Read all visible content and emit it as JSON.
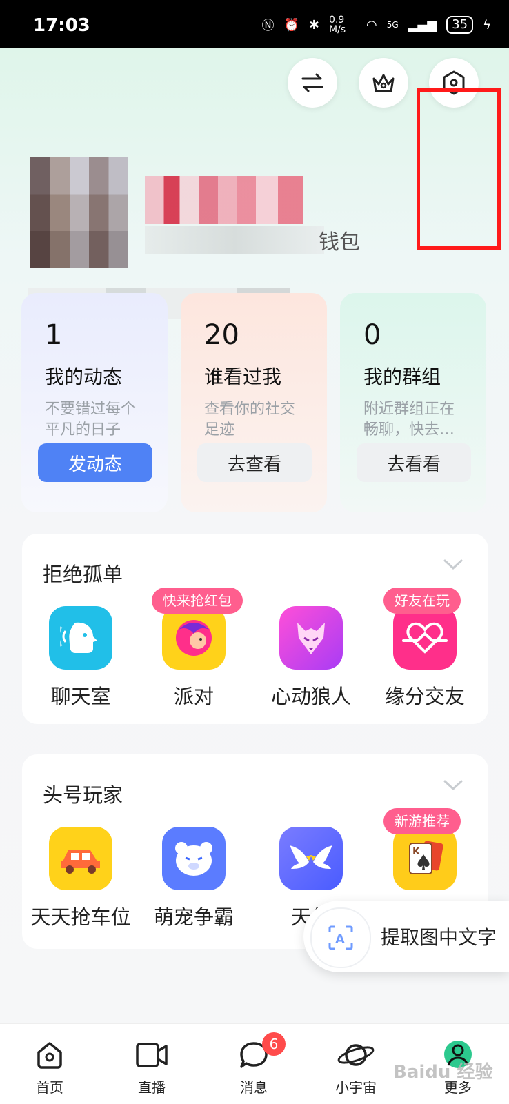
{
  "status_bar": {
    "time": "17:03",
    "network_speed": "0.9 M/s",
    "signal": "5G",
    "battery": "35"
  },
  "profile": {
    "wallet_suffix": "钱包"
  },
  "stats": [
    {
      "count": "1",
      "title": "我的动态",
      "desc": "不要错过每个平凡的日子",
      "button": "发动态"
    },
    {
      "count": "20",
      "title": "谁看过我",
      "desc": "查看你的社交足迹",
      "button": "去查看"
    },
    {
      "count": "0",
      "title": "我的群组",
      "desc": "附近群组正在畅聊，快去…",
      "button": "去看看"
    }
  ],
  "section_social": {
    "title": "拒绝孤单",
    "apps": [
      {
        "label": "聊天室",
        "icon": "chatroom-icon",
        "color": "#21bfe8",
        "tag": ""
      },
      {
        "label": "派对",
        "icon": "party-icon",
        "color": "#ffd21a",
        "tag": "快来抢红包"
      },
      {
        "label": "心动狼人",
        "icon": "werewolf-icon",
        "color": "#d63af0",
        "tag": ""
      },
      {
        "label": "缘分交友",
        "icon": "heart-link-icon",
        "color": "#ff2f8a",
        "tag": "好友在玩"
      }
    ]
  },
  "section_games": {
    "title": "头号玩家",
    "apps": [
      {
        "label": "天天抢车位",
        "icon": "car-icon",
        "color": "#ffd21a",
        "tag": ""
      },
      {
        "label": "萌宠争霸",
        "icon": "bear-icon",
        "color": "#5b7cff",
        "tag": ""
      },
      {
        "label": "天使",
        "icon": "wings-icon",
        "color": "#5b6bff",
        "tag": ""
      },
      {
        "label": "",
        "icon": "card-game-icon",
        "color": "#ffcc1a",
        "tag": "新游推荐"
      }
    ]
  },
  "ocr_button": {
    "label": "提取图中文字"
  },
  "tabbar": [
    {
      "label": "首页",
      "icon": "home-icon"
    },
    {
      "label": "直播",
      "icon": "video-icon"
    },
    {
      "label": "消息",
      "icon": "message-icon",
      "badge": "6"
    },
    {
      "label": "小宇宙",
      "icon": "planet-icon"
    },
    {
      "label": "更多",
      "icon": "more-icon"
    }
  ],
  "watermark": "Baidu 经验",
  "colors": {
    "primary": "#4f82f5",
    "highlight": "#ff1a1a",
    "badge": "#ff4b4b",
    "tag": "#ff5e8e"
  }
}
